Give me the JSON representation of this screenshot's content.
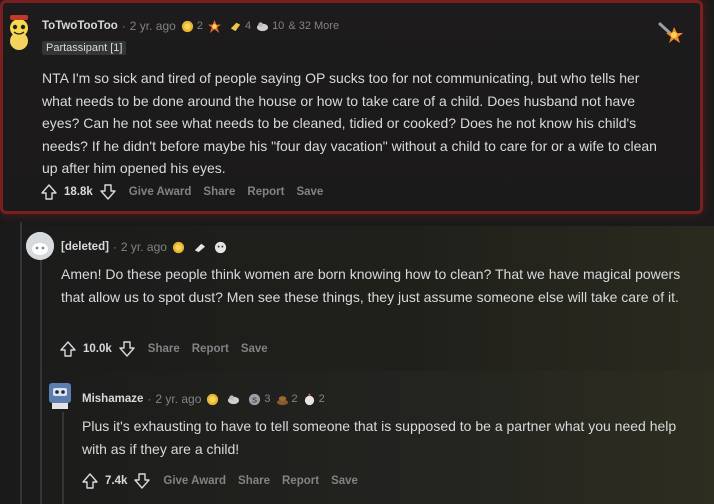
{
  "comments": [
    {
      "username": "ToTwoTooToo",
      "age": "2 yr. ago",
      "flair": "Partassipant [1]",
      "awards": [
        {
          "icon": "gold-award-icon",
          "count": "2"
        },
        {
          "icon": "explosion-award-icon",
          "count": ""
        },
        {
          "icon": "hand-award-icon",
          "count": "4"
        },
        {
          "icon": "wholesome-award-icon",
          "count": "10"
        }
      ],
      "awards_more": "& 32 More",
      "body": "NTA I'm so sick and tired of people saying OP sucks too for not communicating, but who tells her what needs to be done around the house or how to take care of a child. Does husband not have eyes? Can he not see what needs to be cleaned, tidied or cooked? Does he not know his child's needs? If he didn't before maybe his \"four day vacation\" without a child to care for or a wife to clean up after him opened his eyes.",
      "score": "18.8k",
      "actions": [
        "Give Award",
        "Share",
        "Report",
        "Save"
      ]
    },
    {
      "username": "[deleted]",
      "age": "2 yr. ago",
      "body": "Amen! Do these people think women are born knowing how to clean? That we have magical powers that allow us to spot dust? Men see these things, they just assume someone else will take care of it.",
      "score": "10.0k",
      "actions": [
        "Share",
        "Report",
        "Save"
      ]
    },
    {
      "username": "Mishamaze",
      "age": "2 yr. ago",
      "awards": [
        {
          "icon": "gold-award-icon",
          "count": ""
        },
        {
          "icon": "wholesome-award-icon",
          "count": ""
        },
        {
          "icon": "silver-award-icon",
          "count": "3"
        },
        {
          "icon": "poop-award-icon",
          "count": "2"
        },
        {
          "icon": "robot-award-icon",
          "count": "2"
        }
      ],
      "body": "Plus it's exhausting to have to tell someone that is supposed to be a partner what you need help with as if they are a child!",
      "score": "7.4k",
      "actions": [
        "Give Award",
        "Share",
        "Report",
        "Save"
      ]
    }
  ]
}
